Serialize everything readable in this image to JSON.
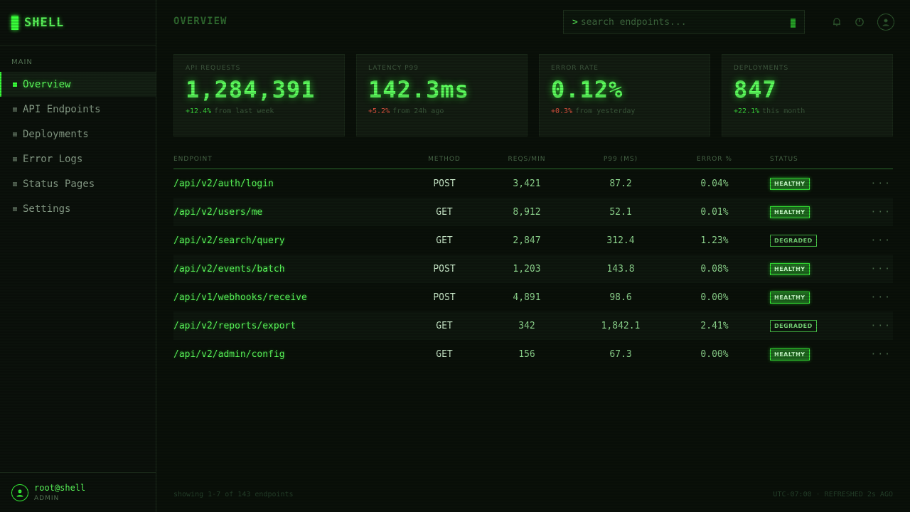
{
  "app": {
    "brand": "SHELL"
  },
  "sidebar": {
    "section_label": "MAIN",
    "items": [
      {
        "label": "Overview",
        "active": true
      },
      {
        "label": "API Endpoints"
      },
      {
        "label": "Deployments"
      },
      {
        "label": "Error Logs"
      },
      {
        "label": "Status Pages"
      },
      {
        "label": "Settings"
      }
    ],
    "user": {
      "name": "root@shell",
      "role": "ADMIN"
    }
  },
  "header": {
    "title": "OVERVIEW",
    "search": {
      "prompt": ">",
      "placeholder": "search endpoints..."
    }
  },
  "stats": [
    {
      "label": "API REQUESTS",
      "value": "1,284,391",
      "delta": "+12.4%",
      "delta_kind": "up",
      "note": "from last week"
    },
    {
      "label": "LATENCY P99",
      "value": "142.3ms",
      "delta": "+5.2%",
      "delta_kind": "bad",
      "note": "from 24h ago"
    },
    {
      "label": "ERROR RATE",
      "value": "0.12%",
      "delta": "+0.3%",
      "delta_kind": "bad",
      "note": "from yesterday"
    },
    {
      "label": "DEPLOYMENTS",
      "value": "847",
      "delta": "+22.1%",
      "delta_kind": "up",
      "note": "this month"
    }
  ],
  "table": {
    "columns": {
      "endpoint": "ENDPOINT",
      "method": "METHOD",
      "reqs": "REQS/MIN",
      "p99": "P99 (MS)",
      "error": "ERROR %",
      "status": "STATUS"
    },
    "actions_label": "···",
    "rows": [
      {
        "endpoint": "/api/v2/auth/login",
        "method": "POST",
        "reqs": "3,421",
        "p99": "87.2",
        "error": "0.04%",
        "status": "HEALTHY"
      },
      {
        "endpoint": "/api/v2/users/me",
        "method": "GET",
        "reqs": "8,912",
        "p99": "52.1",
        "error": "0.01%",
        "status": "HEALTHY"
      },
      {
        "endpoint": "/api/v2/search/query",
        "method": "GET",
        "reqs": "2,847",
        "p99": "312.4",
        "error": "1.23%",
        "status": "DEGRADED"
      },
      {
        "endpoint": "/api/v2/events/batch",
        "method": "POST",
        "reqs": "1,203",
        "p99": "143.8",
        "error": "0.08%",
        "status": "HEALTHY"
      },
      {
        "endpoint": "/api/v1/webhooks/receive",
        "method": "POST",
        "reqs": "4,891",
        "p99": "98.6",
        "error": "0.00%",
        "status": "HEALTHY"
      },
      {
        "endpoint": "/api/v2/reports/export",
        "method": "GET",
        "reqs": "342",
        "p99": "1,842.1",
        "error": "2.41%",
        "status": "DEGRADED"
      },
      {
        "endpoint": "/api/v2/admin/config",
        "method": "GET",
        "reqs": "156",
        "p99": "67.3",
        "error": "0.00%",
        "status": "HEALTHY"
      }
    ]
  },
  "footer": {
    "left": "showing 1-7 of 143 endpoints",
    "right": "UTC-07:00 · REFRESHED 2s AGO"
  },
  "icons": {
    "bell": "bell-icon",
    "power": "power-icon",
    "user": "user-icon"
  },
  "colors": {
    "accent": "#39ff3a",
    "background": "#0a1009",
    "error": "#e2533f"
  }
}
